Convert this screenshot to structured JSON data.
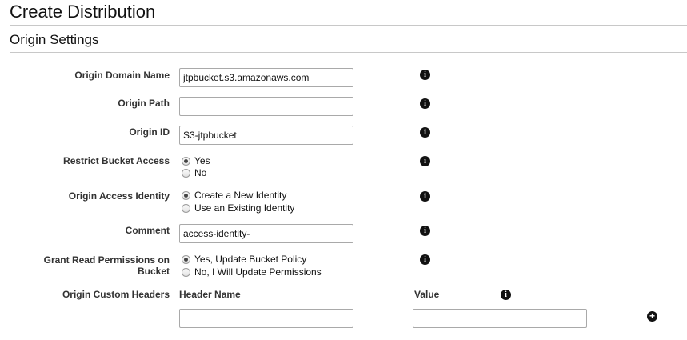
{
  "page": {
    "title": "Create Distribution",
    "section_title": "Origin Settings"
  },
  "fields": {
    "origin_domain_name": {
      "label": "Origin Domain Name",
      "value": "jtpbucket.s3.amazonaws.com"
    },
    "origin_path": {
      "label": "Origin Path",
      "value": ""
    },
    "origin_id": {
      "label": "Origin ID",
      "value": "S3-jtpbucket"
    },
    "restrict_bucket_access": {
      "label": "Restrict Bucket Access",
      "options": [
        "Yes",
        "No"
      ],
      "selected": "Yes"
    },
    "origin_access_identity": {
      "label": "Origin Access Identity",
      "options": [
        "Create a New Identity",
        "Use an Existing Identity"
      ],
      "selected": "Create a New Identity"
    },
    "comment": {
      "label": "Comment",
      "value": "access-identity-"
    },
    "grant_read_permissions": {
      "label_line1": "Grant Read Permissions on",
      "label_line2": "Bucket",
      "options": [
        "Yes, Update Bucket Policy",
        "No, I Will Update Permissions"
      ],
      "selected": "Yes, Update Bucket Policy"
    },
    "origin_custom_headers": {
      "label": "Origin Custom Headers",
      "header_name_label": "Header Name",
      "value_label": "Value",
      "header_name_value": "",
      "value_value": ""
    }
  },
  "icons": {
    "info": "info-icon",
    "add": "plus-circle-icon",
    "info_glyph": "i",
    "add_glyph": "+"
  }
}
